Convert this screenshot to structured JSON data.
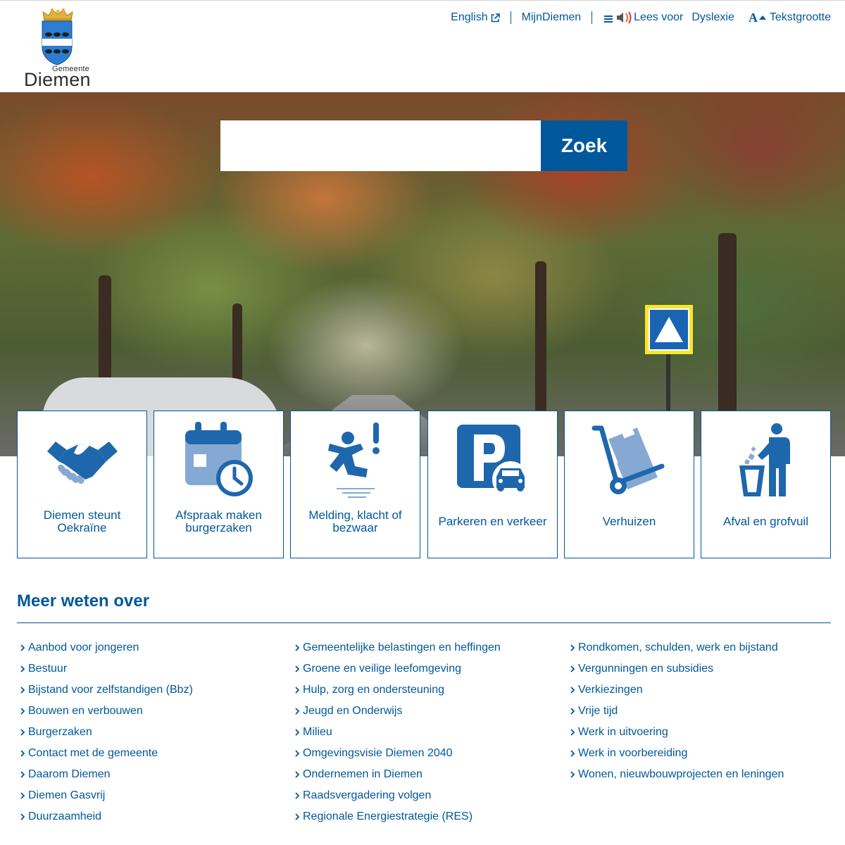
{
  "logo": {
    "small": "Gemeente",
    "big": "Diemen"
  },
  "topnav": {
    "english": "English",
    "mijn": "MijnDiemen",
    "lees": "Lees voor",
    "dyslexie": "Dyslexie",
    "tekstgrootte": "Tekstgrootte"
  },
  "search": {
    "placeholder": "",
    "button": "Zoek"
  },
  "tiles": [
    {
      "label": "Diemen steunt Oekraïne",
      "icon": "handshake-icon"
    },
    {
      "label": "Afspraak maken burgerzaken",
      "icon": "calendar-clock-icon"
    },
    {
      "label": "Melding, klacht of bezwaar",
      "icon": "slip-warning-icon"
    },
    {
      "label": "Parkeren en verkeer",
      "icon": "parking-car-icon"
    },
    {
      "label": "Verhuizen",
      "icon": "hand-truck-icon"
    },
    {
      "label": "Afval en grofvuil",
      "icon": "waste-bin-person-icon"
    }
  ],
  "meer": {
    "title": "Meer weten over",
    "col1": [
      "Aanbod voor jongeren",
      "Bestuur",
      "Bijstand voor zelfstandigen (Bbz)",
      "Bouwen en verbouwen",
      "Burgerzaken",
      "Contact met de gemeente",
      "Daarom Diemen",
      "Diemen Gasvrij",
      "Duurzaamheid"
    ],
    "col2": [
      "Gemeentelijke belastingen en heffingen",
      "Groene en veilige leefomgeving",
      "Hulp, zorg en ondersteuning",
      "Jeugd en Onderwijs",
      "Milieu",
      "Omgevingsvisie Diemen 2040",
      "Ondernemen in Diemen",
      "Raadsvergadering volgen",
      "Regionale Energiestrategie (RES)"
    ],
    "col3": [
      "Rondkomen, schulden, werk en bijstand",
      "Vergunningen en subsidies",
      "Verkiezingen",
      "Vrije tijd",
      "Werk in uitvoering",
      "Werk in voorbereiding",
      "Wonen, nieuwbouwprojecten en leningen"
    ]
  },
  "colors": {
    "brand": "#00589a",
    "tile_icon_dark": "#1f67ad",
    "tile_icon_light": "#86a9d4"
  }
}
